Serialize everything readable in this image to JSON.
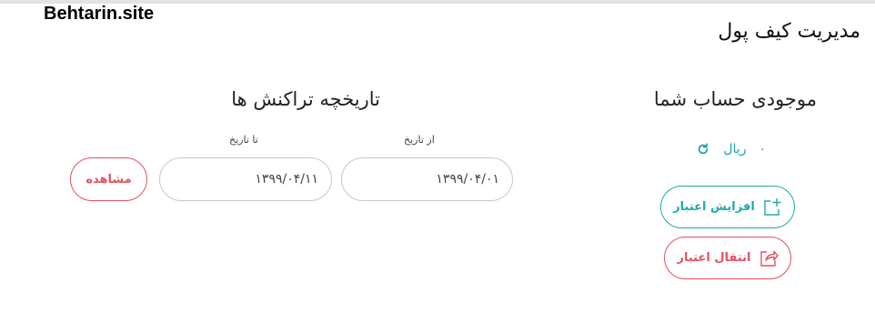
{
  "watermark": "Behtarin.site",
  "page_title": "مدیریت کیف پول",
  "balance": {
    "title": "موجودی حساب شما",
    "value": "۰",
    "unit": "ریال",
    "refresh_icon": "refresh-icon"
  },
  "actions": {
    "increase_label": "افزایش اعتبار",
    "transfer_label": "انتقال اعتبار"
  },
  "history": {
    "title": "تاریخچه تراکنش ها",
    "from_label": "از تاریخ",
    "from_value": "۱۳۹۹/۰۴/۰۱",
    "to_label": "تا تاریخ",
    "to_value": "۱۳۹۹/۰۴/۱۱",
    "view_label": "مشاهده"
  },
  "colors": {
    "teal": "#21a9a9",
    "red": "#e05262"
  }
}
